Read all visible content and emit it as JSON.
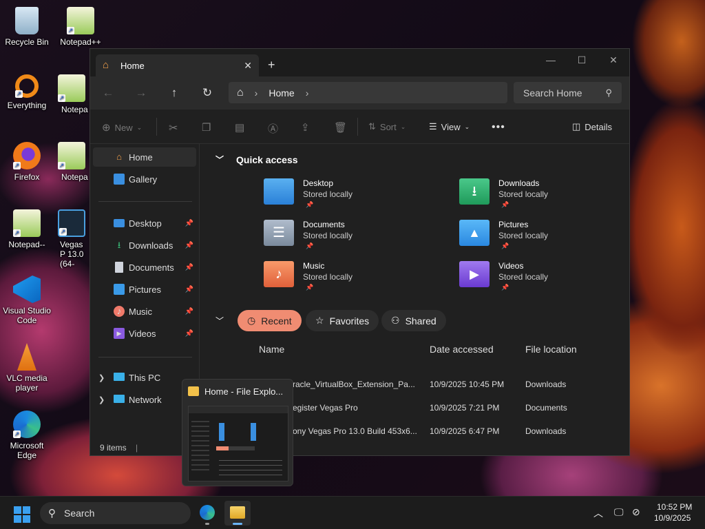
{
  "desktop": {
    "icons": [
      {
        "label": "Recycle Bin"
      },
      {
        "label": "Notepad++"
      },
      {
        "label": "Everything"
      },
      {
        "label": "Notepa"
      },
      {
        "label": "Firefox"
      },
      {
        "label": "Notepa"
      },
      {
        "label": "Notepad--"
      },
      {
        "label": "Vegas P 13.0 (64-"
      },
      {
        "label": "Visual Studio Code"
      },
      {
        "label": "VLC media player"
      },
      {
        "label": "Microsoft Edge"
      }
    ]
  },
  "window": {
    "tab_title": "Home",
    "address_root": "Home",
    "search_placeholder": "Search Home",
    "toolbar": {
      "new": "New",
      "sort": "Sort",
      "view": "View",
      "details": "Details"
    },
    "sidebar": {
      "home": "Home",
      "gallery": "Gallery",
      "pinned": [
        {
          "label": "Desktop"
        },
        {
          "label": "Downloads"
        },
        {
          "label": "Documents"
        },
        {
          "label": "Pictures"
        },
        {
          "label": "Music"
        },
        {
          "label": "Videos"
        }
      ],
      "this_pc": "This PC",
      "network": "Network"
    },
    "status": "9 items",
    "quick_access": {
      "title": "Quick access",
      "items": [
        {
          "name": "Desktop",
          "sub": "Stored locally",
          "color": "#3a8fe0"
        },
        {
          "name": "Downloads",
          "sub": "Stored locally",
          "color": "#2fb06a"
        },
        {
          "name": "Documents",
          "sub": "Stored locally",
          "color": "#8a9bb0"
        },
        {
          "name": "Pictures",
          "sub": "Stored locally",
          "color": "#3a9ae8"
        },
        {
          "name": "Music",
          "sub": "Stored locally",
          "color": "#f07a4a"
        },
        {
          "name": "Videos",
          "sub": "Stored locally",
          "color": "#8a5ae0"
        }
      ]
    },
    "filters": {
      "recent": "Recent",
      "favorites": "Favorites",
      "shared": "Shared"
    },
    "columns": {
      "name": "Name",
      "date": "Date accessed",
      "location": "File location"
    },
    "files": [
      {
        "name": "racle_VirtualBox_Extension_Pa...",
        "date": "10/9/2025 10:45 PM",
        "location": "Downloads"
      },
      {
        "name": "egister Vegas Pro",
        "date": "10/9/2025 7:21 PM",
        "location": "Documents"
      },
      {
        "name": "ony Vegas Pro 13.0 Build 453x6...",
        "date": "10/9/2025 6:47 PM",
        "location": "Downloads"
      }
    ]
  },
  "thumbnail": {
    "title": "Home - File Explo..."
  },
  "taskbar": {
    "search": "Search",
    "time": "10:52 PM",
    "date": "10/9/2025"
  }
}
